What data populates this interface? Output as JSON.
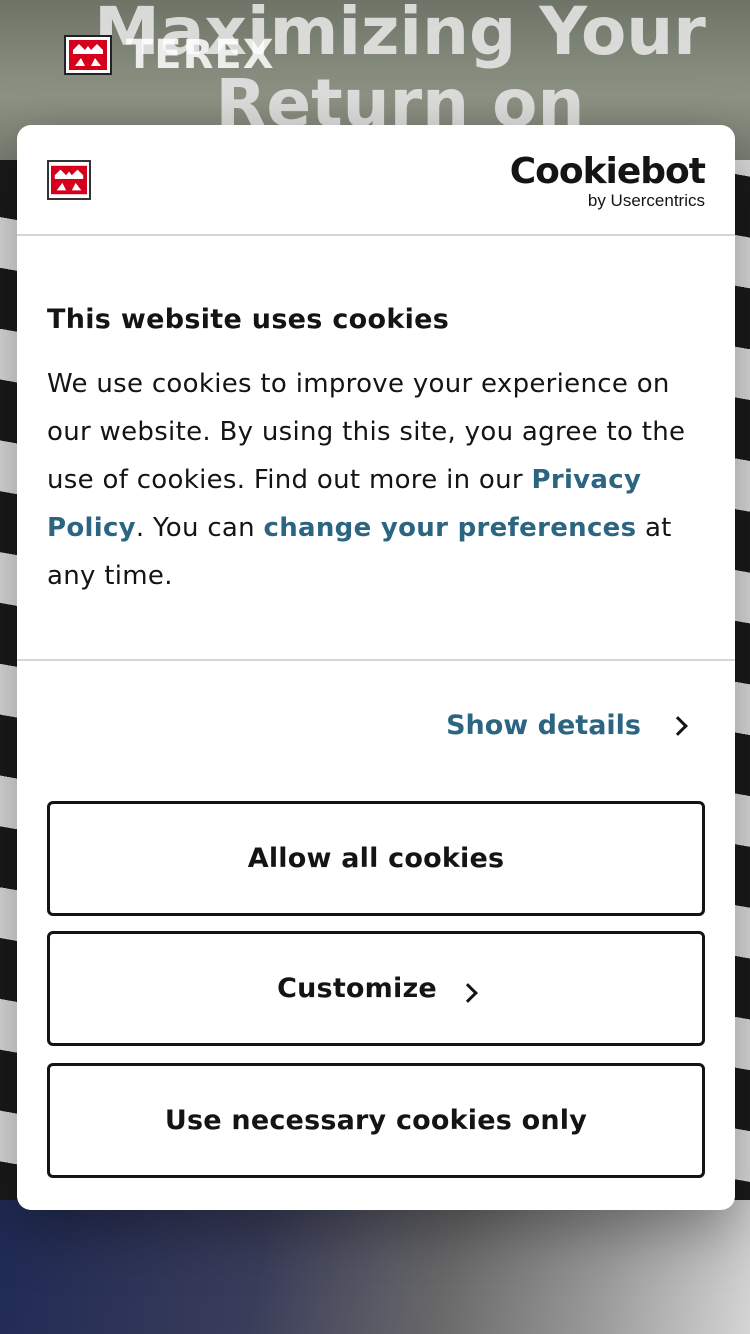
{
  "background": {
    "hero_title": "Maximizing Your Return on",
    "site_logo_text": "TEREX"
  },
  "dialog": {
    "provider_name": "Cookiebot",
    "provider_sub": "by Usercentrics",
    "title": "This website uses cookies",
    "text_part1": "We use cookies to improve your experience on our website. By using this site, you agree to the use of cookies. Find out more in our ",
    "privacy_link": "Privacy Policy",
    "text_part2": ". You can ",
    "preferences_link": "change your preferences",
    "text_part3": " at any time.",
    "show_details": "Show details",
    "buttons": {
      "allow_all": "Allow all cookies",
      "customize": "Customize",
      "necessary_only": "Use necessary cookies only"
    }
  },
  "colors": {
    "link": "#2b6582",
    "text": "#141414",
    "brand_red": "#d6001c"
  }
}
